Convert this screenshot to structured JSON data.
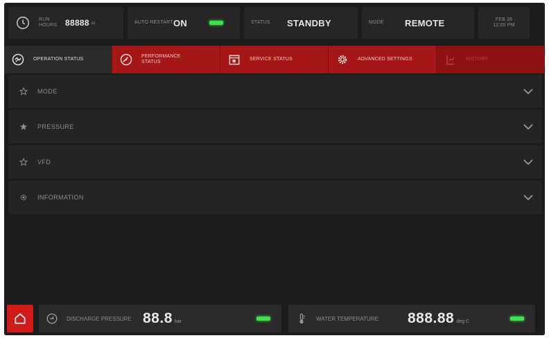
{
  "status_bar": {
    "run_hours_label": "Run Hours",
    "run_hours_value": "88888",
    "run_hours_unit": "h",
    "auto_restart_label": "Auto Restart",
    "auto_restart_value": "ON",
    "status_label": "Status",
    "status_value": "STANDBY",
    "mode_label": "Mode",
    "mode_value": "REMOTE",
    "date": "Feb 26",
    "time": "12:00 PM"
  },
  "tabs": [
    {
      "label": "Operation Status",
      "icon": "operation-icon",
      "active": true,
      "disabled": false
    },
    {
      "label": "Performance Status",
      "icon": "speedometer-icon",
      "active": false,
      "disabled": false
    },
    {
      "label": "Service Status",
      "icon": "calendar-icon",
      "active": false,
      "disabled": false
    },
    {
      "label": "Advanced Settings",
      "icon": "gear-icon",
      "active": false,
      "disabled": false
    },
    {
      "label": "History",
      "icon": "history-icon",
      "active": false,
      "disabled": true
    }
  ],
  "accordion": [
    {
      "label": "Mode",
      "icon": "star-outline-icon"
    },
    {
      "label": "Pressure",
      "icon": "star-filled-icon"
    },
    {
      "label": "VFD",
      "icon": "star-outline-icon"
    },
    {
      "label": "Information",
      "icon": "info-gear-icon"
    }
  ],
  "bottom": {
    "discharge_pressure_label": "Discharge Pressure",
    "discharge_pressure_value": "88.8",
    "discharge_pressure_unit": "bar",
    "water_temperature_label": "Water Temperature",
    "water_temperature_value": "888.88",
    "water_temperature_unit": "deg C"
  },
  "colors": {
    "accent_red": "#c81a1a",
    "tab_red": "#a51616",
    "led_green": "#3ee34a",
    "background": "#1b1b1b"
  }
}
